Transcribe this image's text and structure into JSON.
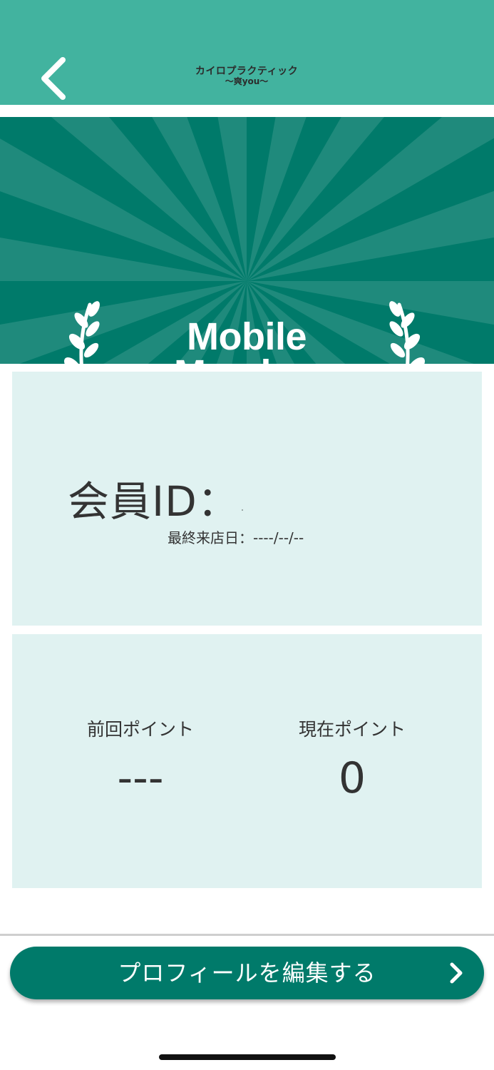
{
  "header": {
    "logo_line1": "カイロプラクティック",
    "logo_line2": "〜爽you〜",
    "back_icon": "chevron-left-icon"
  },
  "banner": {
    "title_line1": "Mobile",
    "title_line2": "Member",
    "decoration_icon": "laurel-icon"
  },
  "member": {
    "id_label": "会員ID：",
    "last_visit": "最終来店日：----/--/--"
  },
  "points": {
    "previous_label": "前回ポイント",
    "previous_value": "---",
    "current_label": "現在ポイント",
    "current_value": "0"
  },
  "actions": {
    "edit_profile_label": "プロフィールを編集する",
    "chevron_icon": "chevron-right-icon"
  },
  "colors": {
    "header": "#42b39f",
    "banner": "#007a6a",
    "card": "#e0f2f1",
    "button": "#007a6a"
  }
}
